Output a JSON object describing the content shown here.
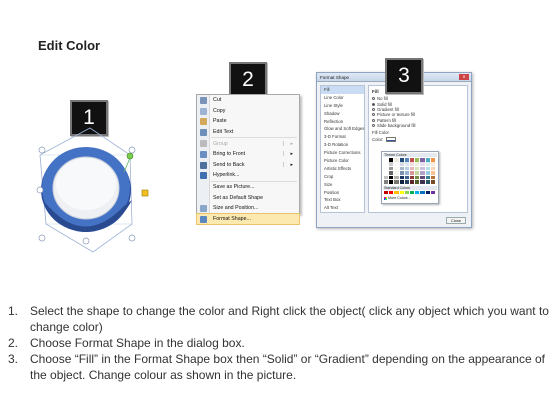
{
  "title": "Edit Color",
  "steps": [
    "1",
    "2",
    "3"
  ],
  "context_menu": {
    "items": [
      {
        "label": "Cut",
        "ul": "t",
        "icon_color": "#7a93b8",
        "enabled": true
      },
      {
        "label": "Copy",
        "icon_color": "#9fb4d4",
        "enabled": true
      },
      {
        "label": "Paste",
        "icon_color": "#d2a95a",
        "enabled": true
      },
      {
        "label": "Edit Text",
        "icon_color": "#6d8fb9",
        "enabled": true
      },
      {
        "sep": true
      },
      {
        "label": "Group",
        "icon_color": "#bbbbbb",
        "enabled": false,
        "submenu": true
      },
      {
        "label": "Bring to Front",
        "icon_color": "#6a8dc2",
        "enabled": true,
        "submenu": true
      },
      {
        "label": "Send to Back",
        "icon_color": "#4f6f9c",
        "enabled": true,
        "submenu": true
      },
      {
        "label": "Hyperlink...",
        "icon_color": "#3f6fb1",
        "enabled": true
      },
      {
        "sep": true
      },
      {
        "label": "Save as Picture...",
        "icon_color": "",
        "enabled": true
      },
      {
        "label": "Set as Default Shape",
        "icon_color": "",
        "enabled": true
      },
      {
        "label": "Size and Position...",
        "icon_color": "#8aa6c8",
        "enabled": true
      },
      {
        "label": "Format Shape...",
        "icon_color": "#5b86bf",
        "enabled": true,
        "highlighted": true
      }
    ]
  },
  "format_shape_dialog": {
    "title": "Format Shape",
    "categories": [
      "Fill",
      "Line Color",
      "Line Style",
      "Shadow",
      "Reflection",
      "Glow and Soft Edges",
      "3-D Format",
      "3-D Rotation",
      "Picture Corrections",
      "Picture Color",
      "Artistic Effects",
      "Crop",
      "Size",
      "Position",
      "Text Box",
      "Alt Text"
    ],
    "selected_category": "Fill",
    "panel_heading": "Fill",
    "fill_options": [
      "No fill",
      "Solid fill",
      "Gradient fill",
      "Picture or texture fill",
      "Pattern fill",
      "Slide background fill"
    ],
    "selected_fill": "Solid fill",
    "fill_color_label": "Fill Color",
    "color_label": "Color:",
    "close_label": "Close"
  },
  "color_palette": {
    "theme_label": "Theme Colors",
    "theme_colors": [
      "#ffffff",
      "#000000",
      "#eeece1",
      "#1f497d",
      "#4f81bd",
      "#c0504d",
      "#9bbb59",
      "#8064a2",
      "#4bacc6",
      "#f79646"
    ],
    "standard_label": "Standard Colors",
    "standard_colors": [
      "#c00000",
      "#ff0000",
      "#ffc000",
      "#ffff00",
      "#92d050",
      "#00b050",
      "#00b0f0",
      "#0070c0",
      "#002060",
      "#7030a0"
    ],
    "more_label": "More Colors..."
  },
  "accent_color": "#2f54a0",
  "instructions": [
    {
      "num": "1.",
      "text": "Select the shape to change the color and Right click the object( click any object which you want to change color)"
    },
    {
      "num": "2.",
      "text": "Choose Format Shape in the dialog box."
    },
    {
      "num": "3.",
      "text": "Choose “Fill” in the Format Shape box then “Solid” or “Gradient” depending on the appearance of the object. Change colour as shown in the picture."
    }
  ]
}
